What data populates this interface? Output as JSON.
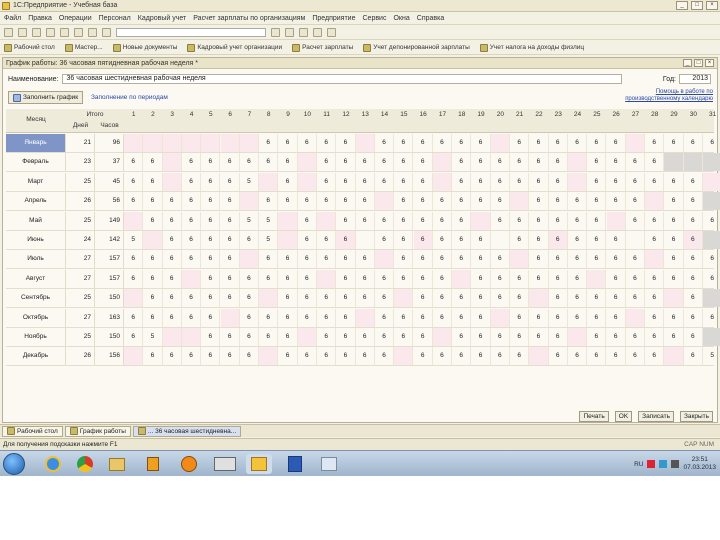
{
  "title": "1С:Предприятие - Учебная база",
  "menu": [
    "Файл",
    "Правка",
    "Операции",
    "Персонал",
    "Кадровый учет",
    "Расчет зарплаты по организациям",
    "Предприятие",
    "Сервис",
    "Окна",
    "Справка"
  ],
  "toolbar2": [
    "Рабочий стол",
    "Мастер...",
    "Новые документы",
    "Кадровый учет организации",
    "Расчет зарплаты",
    "Учет депонированной зарплаты",
    "Учет налога на доходы физлиц"
  ],
  "doc_title": "График работы: 36 часовая пятидневная рабочая неделя *",
  "form": {
    "name_label": "Наименование:",
    "name_value": "36 часовая шестидневная рабочая неделя",
    "year_label": "Год:",
    "year_value": "2013",
    "fill_button": "Заполнить график",
    "tab_link": "Заполнение по периодам",
    "right_link": "Помощь в работе по производственному календарю"
  },
  "headers": {
    "month": "Месяц",
    "total": "Итого",
    "days": "Дней",
    "hours": "Часов"
  },
  "day_numbers": [
    "1",
    "2",
    "3",
    "4",
    "5",
    "6",
    "7",
    "8",
    "9",
    "10",
    "11",
    "12",
    "13",
    "14",
    "15",
    "16",
    "17",
    "18",
    "19",
    "20",
    "21",
    "22",
    "23",
    "24",
    "25",
    "26",
    "27",
    "28",
    "29",
    "30",
    "31"
  ],
  "months": [
    {
      "name": "Январь",
      "days": "21",
      "hours": "96",
      "cells": [
        "",
        "",
        "",
        "",
        "",
        "",
        "",
        "6",
        "6",
        "6",
        "6",
        "6",
        "",
        "6",
        "6",
        "6",
        "6",
        "6",
        "6",
        "",
        "6",
        "6",
        "6",
        "6",
        "6",
        "6",
        "",
        "6",
        "6",
        "6",
        "6"
      ],
      "off": [
        1,
        2,
        3,
        4,
        5,
        6,
        7,
        13,
        20,
        27
      ],
      "selected": true
    },
    {
      "name": "Февраль",
      "days": "23",
      "hours": "37",
      "cells": [
        "6",
        "6",
        "",
        "6",
        "6",
        "6",
        "6",
        "6",
        "6",
        "",
        "6",
        "6",
        "6",
        "6",
        "6",
        "6",
        "",
        "6",
        "6",
        "6",
        "6",
        "6",
        "6",
        "",
        "6",
        "6",
        "6",
        "6",
        "",
        "",
        ""
      ],
      "off": [
        3,
        10,
        17,
        24
      ],
      "na": [
        29,
        30,
        31
      ]
    },
    {
      "name": "Март",
      "days": "25",
      "hours": "45",
      "cells": [
        "6",
        "6",
        "",
        "6",
        "6",
        "6",
        "5",
        "",
        "6",
        "",
        "6",
        "6",
        "6",
        "6",
        "6",
        "6",
        "",
        "6",
        "6",
        "6",
        "6",
        "6",
        "6",
        "",
        "6",
        "6",
        "6",
        "6",
        "6",
        "6",
        ""
      ],
      "off": [
        3,
        8,
        10,
        17,
        24,
        31
      ]
    },
    {
      "name": "Апрель",
      "days": "26",
      "hours": "56",
      "cells": [
        "6",
        "6",
        "6",
        "6",
        "6",
        "6",
        "",
        "6",
        "6",
        "6",
        "6",
        "6",
        "6",
        "",
        "6",
        "6",
        "6",
        "6",
        "6",
        "6",
        "",
        "6",
        "6",
        "6",
        "6",
        "6",
        "6",
        "",
        "6",
        "6",
        ""
      ],
      "off": [
        7,
        14,
        21,
        28
      ],
      "na": [
        31
      ]
    },
    {
      "name": "Май",
      "days": "25",
      "hours": "149",
      "cells": [
        "",
        "6",
        "6",
        "6",
        "6",
        "6",
        "5",
        "5",
        "",
        "6",
        "",
        "6",
        "6",
        "6",
        "6",
        "6",
        "6",
        "6",
        "",
        "6",
        "6",
        "6",
        "6",
        "6",
        "6",
        "",
        "6",
        "6",
        "6",
        "6",
        "6"
      ],
      "off": [
        1,
        9,
        11,
        19,
        26
      ]
    },
    {
      "name": "Июнь",
      "days": "24",
      "hours": "142",
      "cells": [
        "5",
        "",
        "6",
        "6",
        "6",
        "6",
        "6",
        "5",
        "",
        "6",
        "6",
        "6",
        "",
        "6",
        "6",
        "6",
        "6",
        "6",
        "6",
        "",
        "6",
        "6",
        "6",
        "6",
        "6",
        "6",
        "",
        "6",
        "6",
        "6",
        ""
      ],
      "off": [
        2,
        9,
        12,
        16,
        23,
        30
      ],
      "na": [
        31
      ]
    },
    {
      "name": "Июль",
      "days": "27",
      "hours": "157",
      "cells": [
        "6",
        "6",
        "6",
        "6",
        "6",
        "6",
        "",
        "6",
        "6",
        "6",
        "6",
        "6",
        "6",
        "",
        "6",
        "6",
        "6",
        "6",
        "6",
        "6",
        "",
        "6",
        "6",
        "6",
        "6",
        "6",
        "6",
        "",
        "6",
        "6",
        "6"
      ],
      "off": [
        7,
        14,
        21,
        28
      ]
    },
    {
      "name": "Август",
      "days": "27",
      "hours": "157",
      "cells": [
        "6",
        "6",
        "6",
        "",
        "6",
        "6",
        "6",
        "6",
        "6",
        "6",
        "",
        "6",
        "6",
        "6",
        "6",
        "6",
        "6",
        "",
        "6",
        "6",
        "6",
        "6",
        "6",
        "6",
        "",
        "6",
        "6",
        "6",
        "6",
        "6",
        "6"
      ],
      "off": [
        4,
        11,
        18,
        25
      ]
    },
    {
      "name": "Сентябрь",
      "days": "25",
      "hours": "150",
      "cells": [
        "",
        "6",
        "6",
        "6",
        "6",
        "6",
        "6",
        "",
        "6",
        "6",
        "6",
        "6",
        "6",
        "6",
        "",
        "6",
        "6",
        "6",
        "6",
        "6",
        "6",
        "",
        "6",
        "6",
        "6",
        "6",
        "6",
        "6",
        "",
        "6",
        ""
      ],
      "off": [
        1,
        8,
        15,
        22,
        29
      ],
      "na": [
        31
      ]
    },
    {
      "name": "Октябрь",
      "days": "27",
      "hours": "163",
      "cells": [
        "6",
        "6",
        "6",
        "6",
        "6",
        "",
        "6",
        "6",
        "6",
        "6",
        "6",
        "6",
        "",
        "6",
        "6",
        "6",
        "6",
        "6",
        "6",
        "",
        "6",
        "6",
        "6",
        "6",
        "6",
        "6",
        "",
        "6",
        "6",
        "6",
        "6"
      ],
      "off": [
        6,
        13,
        20,
        27
      ]
    },
    {
      "name": "Ноябрь",
      "days": "25",
      "hours": "150",
      "cells": [
        "6",
        "5",
        "",
        "",
        "6",
        "6",
        "6",
        "6",
        "6",
        "",
        "6",
        "6",
        "6",
        "6",
        "6",
        "6",
        "",
        "6",
        "6",
        "6",
        "6",
        "6",
        "6",
        "",
        "6",
        "6",
        "6",
        "6",
        "6",
        "6",
        ""
      ],
      "off": [
        3,
        4,
        10,
        17,
        24
      ],
      "na": [
        31
      ]
    },
    {
      "name": "Декабрь",
      "days": "26",
      "hours": "156",
      "cells": [
        "",
        "6",
        "6",
        "6",
        "6",
        "6",
        "6",
        "",
        "6",
        "6",
        "6",
        "6",
        "6",
        "6",
        "",
        "6",
        "6",
        "6",
        "6",
        "6",
        "6",
        "",
        "6",
        "6",
        "6",
        "6",
        "6",
        "6",
        "",
        "6",
        "5"
      ],
      "off": [
        1,
        8,
        15,
        22,
        29
      ]
    }
  ],
  "bottom_buttons": [
    "Печать",
    "OK",
    "Записать",
    "Закрыть"
  ],
  "window_tabs": [
    "Рабочий стол",
    "График работы",
    "... 36 часовая шестидневна..."
  ],
  "status_text": "Для получения подсказки нажмите F1",
  "status_right": "CAP NUM",
  "tray": {
    "lang": "RU",
    "time": "23:51",
    "date": "07.03.2013"
  }
}
